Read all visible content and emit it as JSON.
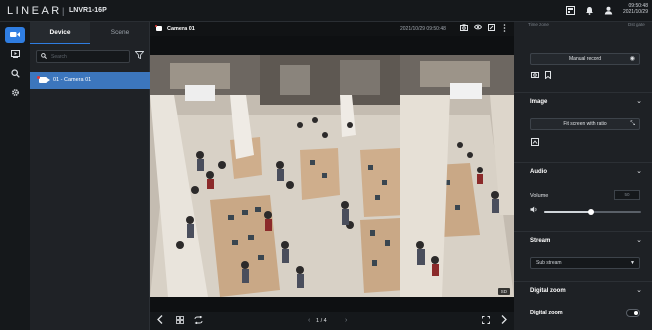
{
  "app": {
    "brand": "LINEAR",
    "separator": "|",
    "device_model": "LNVR1-16P",
    "datetime_line1": "09:50:48",
    "datetime_line2": "2021/10/29"
  },
  "topbar_icons": [
    "layout-icon",
    "bell-icon",
    "user-icon"
  ],
  "nav": {
    "items": [
      {
        "name": "live-view",
        "icon": "camera-icon",
        "active": true
      },
      {
        "name": "playback",
        "icon": "playback-icon",
        "active": false
      },
      {
        "name": "search",
        "icon": "search-icon",
        "active": false
      },
      {
        "name": "settings",
        "icon": "gear-icon",
        "active": false
      }
    ]
  },
  "device_panel": {
    "tabs": [
      {
        "label": "Device",
        "active": true
      },
      {
        "label": "Scene",
        "active": false
      }
    ],
    "search_placeholder": "Search",
    "cameras": [
      {
        "label": "01 - Camera 01",
        "selected": true
      }
    ]
  },
  "viewer": {
    "camera_name": "Camera 01",
    "timestamp": "2021/10/29 09:50:48",
    "header_icons": [
      "snapshot-icon",
      "eye-icon",
      "fullscreen-icon",
      "more-icon"
    ],
    "resolution_tag": "SD",
    "page_indicator": "1 / 4",
    "footer_icons": [
      "prev-icon",
      "grid-icon",
      "sequence-icon",
      "fullscreen-icon",
      "next-icon"
    ]
  },
  "right_panel": {
    "clipped_text_left": "Time zone",
    "clipped_text_right": "Dst gate",
    "manual_record_label": "Manual record",
    "image": {
      "title": "Image",
      "fit_label": "Fit screen with ratio"
    },
    "audio": {
      "title": "Audio",
      "volume_label": "Volume",
      "volume_value": "50",
      "volume_level": 0.48
    },
    "stream": {
      "title": "Stream",
      "selected": "Sub stream"
    },
    "digital_zoom": {
      "title": "Digital zoom",
      "toggle_label": "Digital zoom",
      "enabled": false
    }
  }
}
